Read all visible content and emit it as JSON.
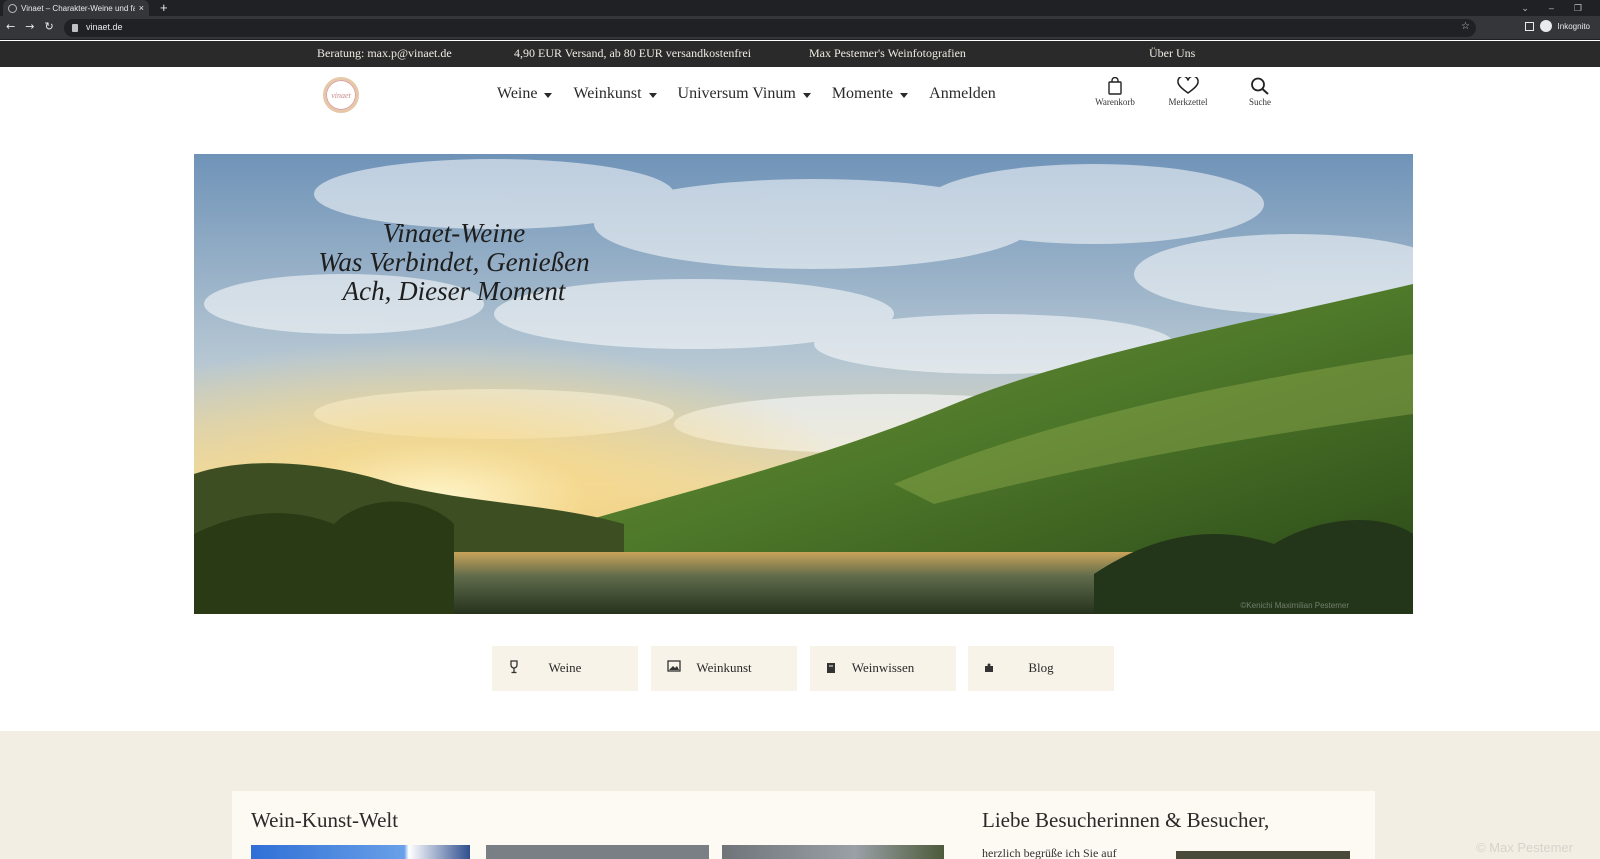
{
  "browser": {
    "tab_title": "Vinaet – Charakter-Weine und fa",
    "tab_close": "×",
    "new_tab": "+",
    "url": "vinaet.de",
    "profile_label": "Inkognito"
  },
  "infobar": {
    "consult": "Beratung: max.p@vinaet.de",
    "shipping": "4,90 EUR Versand, ab 80 EUR versandkostenfrei",
    "photos": "Max Pestemer's Weinfotografien",
    "about": "Über Uns"
  },
  "header": {
    "logo_text": "vinaet",
    "nav": [
      {
        "label": "Weine",
        "has_dropdown": true
      },
      {
        "label": "Weinkunst",
        "has_dropdown": true
      },
      {
        "label": "Universum Vinum",
        "has_dropdown": true
      },
      {
        "label": "Momente",
        "has_dropdown": true
      },
      {
        "label": "Anmelden",
        "has_dropdown": false
      }
    ],
    "icons": [
      {
        "icon": "shopping-bag-icon",
        "label": "Warenkorb"
      },
      {
        "icon": "heart-icon",
        "label": "Merkzettel"
      },
      {
        "icon": "search-icon",
        "label": "Suche"
      }
    ]
  },
  "hero": {
    "line1": "Vinaet-Weine",
    "line2": "Was Verbindet, Genießen",
    "line3": "Ach, Dieser Moment",
    "credit": "©Kenichi Maximilian Pestemer"
  },
  "categories": [
    {
      "icon": "wine-glass-icon",
      "label": "Weine"
    },
    {
      "icon": "image-icon",
      "label": "Weinkunst"
    },
    {
      "icon": "book-icon",
      "label": "Weinwissen"
    },
    {
      "icon": "blog-icon",
      "label": "Blog"
    }
  ],
  "lower": {
    "left_title": "Wein-Kunst-Welt",
    "right_title": "Liebe Besucherinnen & Besucher,",
    "right_text": "herzlich begrüße ich Sie auf"
  },
  "watermark": "© Max Pestemer",
  "colors": {
    "infobar_bg": "#2a2a2a",
    "button_bg": "#f8f3e8",
    "section_bg": "#f3eee4"
  }
}
